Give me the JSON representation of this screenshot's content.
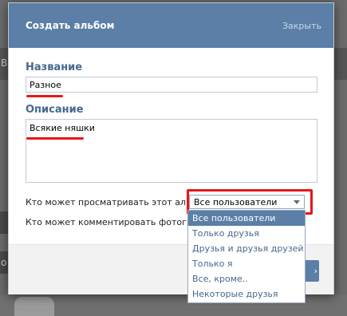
{
  "modal": {
    "title": "Создать альбом",
    "close_label": "Закрыть"
  },
  "form": {
    "name_label": "Название",
    "name_value": "Разное",
    "description_label": "Описание",
    "description_value": "Всякие няшки",
    "view_permission_label": "Кто может просматривать этот альбом?",
    "view_permission_value": "Все пользователи",
    "comment_permission_label": "Кто может комментировать фотографии?"
  },
  "dropdown": {
    "options": [
      "Все пользователи",
      "Только друзья",
      "Друзья и друзья друзей",
      "Только я",
      "Все, кроме..",
      "Некоторые друзья"
    ],
    "selected_index": 0
  },
  "background": {
    "glyph_left": "В",
    "glyph_left_2": "о"
  },
  "accent_colors": {
    "header": "#5b7fa6",
    "label": "#45688e",
    "annotation_red": "#e8161b"
  }
}
